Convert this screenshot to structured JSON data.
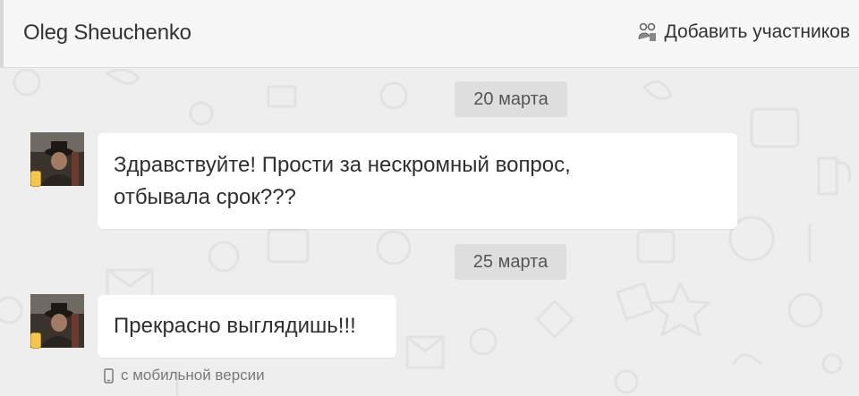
{
  "header": {
    "title": "Oleg Sheuchenko",
    "add_participants_label": "Добавить участников",
    "add_participants_icon": "add-participants-icon"
  },
  "messages": [
    {
      "date": "20 марта",
      "lines": [
        "Здравствуйте! Прости за нескромный вопрос,",
        "отбывала срок???"
      ],
      "avatar_icon": "avatar",
      "device_icon": "mobile-device-icon"
    },
    {
      "date": "25 марта",
      "lines": [
        "Прекрасно выглядишь!!!"
      ],
      "avatar_icon": "avatar",
      "device_icon": "mobile-device-icon"
    }
  ],
  "mobile_note": {
    "icon": "phone-icon",
    "text": "с мобильной версии"
  },
  "colors": {
    "background": "#eeeeee",
    "header": "#f7f7f7",
    "bubble": "#ffffff",
    "date_separator": "#dedede",
    "device_badge": "#f4c64a"
  }
}
